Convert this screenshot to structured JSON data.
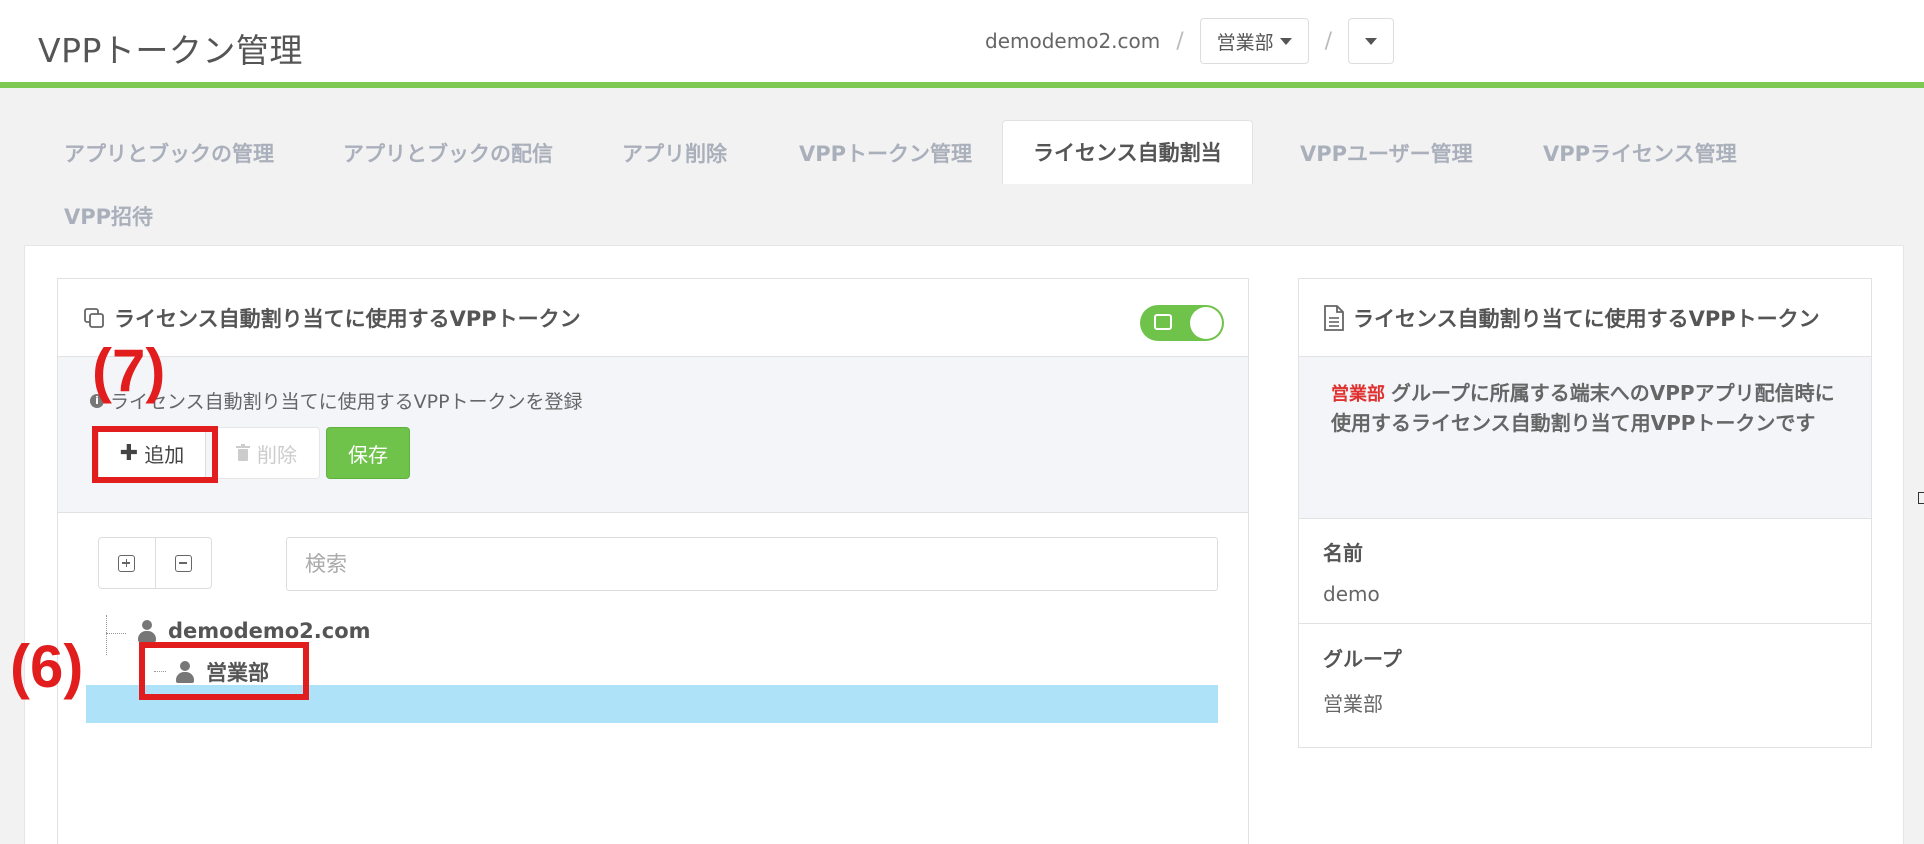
{
  "header": {
    "title": "VPPトークン管理",
    "breadcrumb": {
      "domain": "demodemo2.com",
      "sep": "/",
      "group": "営業部"
    }
  },
  "tabs": [
    {
      "label": "アプリとブックの管理"
    },
    {
      "label": "アプリとブックの配信"
    },
    {
      "label": "アプリ削除"
    },
    {
      "label": "VPPトークン管理"
    },
    {
      "label": "ライセンス自動割当",
      "active": true
    },
    {
      "label": "VPPユーザー管理"
    },
    {
      "label": "VPPライセンス管理"
    },
    {
      "label": "VPP招待"
    }
  ],
  "left_panel": {
    "title": "ライセンス自動割り当てに使用するVPPトークン",
    "info": "ライセンス自動割り当てに使用するVPPトークンを登録",
    "add_label": "追加",
    "delete_label": "削除",
    "save_label": "保存",
    "search_placeholder": "検索",
    "tree": {
      "root": "demodemo2.com",
      "child": "営業部"
    }
  },
  "right_panel": {
    "title": "ライセンス自動割り当てに使用するVPPトークン",
    "tag": "営業部",
    "desc": "グループに所属する端末へのVPPアプリ配信時に使用するライセンス自動割り当て用VPPトークンです",
    "name_label": "名前",
    "name_value": "demo",
    "group_label": "グループ",
    "group_value": "営業部"
  },
  "annotations": {
    "seven": "(7)",
    "six": "(6)"
  },
  "colors": {
    "accent_green": "#7dc953",
    "annotation_red": "#e11d1d",
    "selected_row": "#aee2f8"
  }
}
